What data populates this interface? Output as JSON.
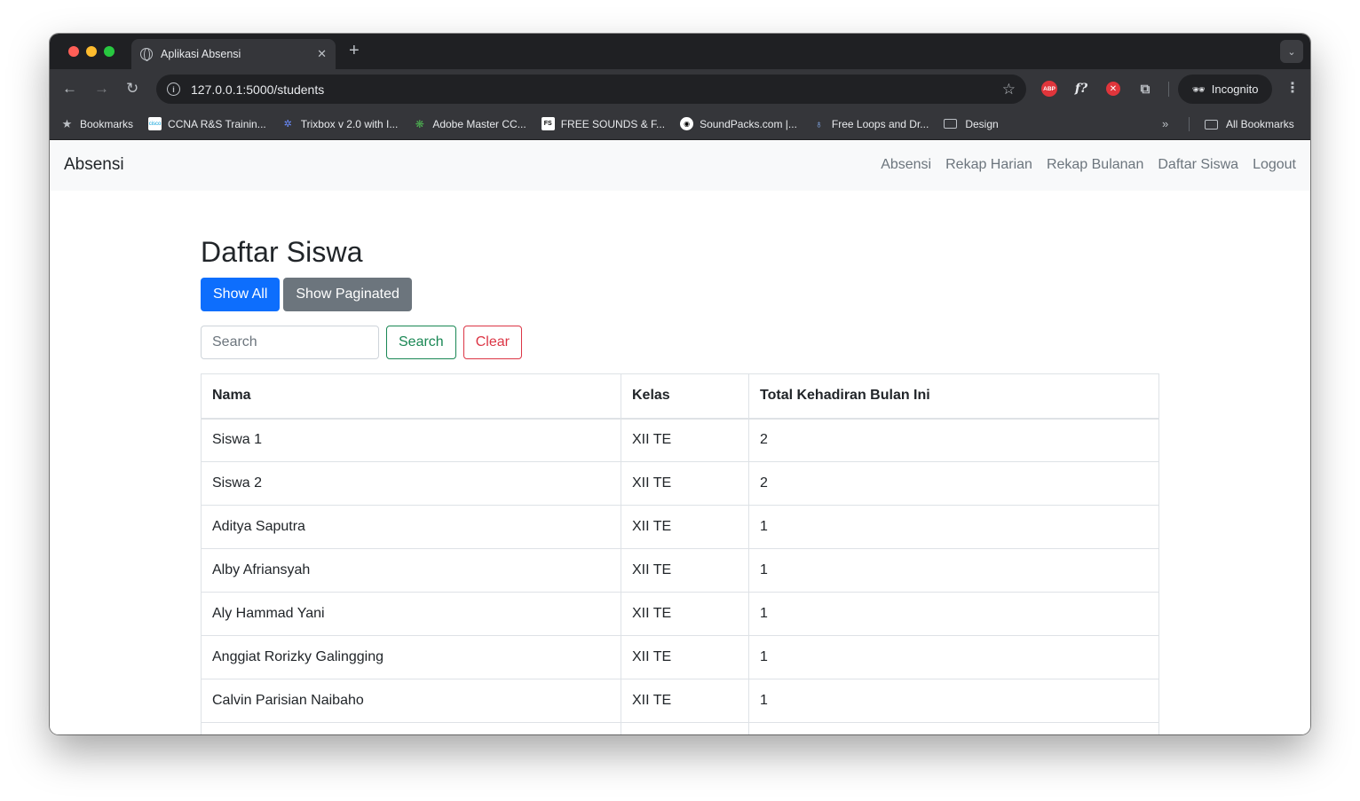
{
  "browser": {
    "tab_title": "Aplikasi Absensi",
    "url": "127.0.0.1:5000/students",
    "incognito_label": "Incognito",
    "bookmarks": [
      {
        "label": "Bookmarks",
        "icon": "star-icon"
      },
      {
        "label": "CCNA R&S Trainin...",
        "icon": "cisco-icon"
      },
      {
        "label": "Trixbox v 2.0 with I...",
        "icon": "trixbox-icon"
      },
      {
        "label": "Adobe Master CC...",
        "icon": "adobe-icon"
      },
      {
        "label": "FREE SOUNDS & F...",
        "icon": "free-sounds-icon"
      },
      {
        "label": "SoundPacks.com |...",
        "icon": "soundpacks-icon"
      },
      {
        "label": "Free Loops and Dr...",
        "icon": "free-loops-icon"
      },
      {
        "label": "Design",
        "icon": "folder-icon"
      }
    ],
    "all_bookmarks_label": "All Bookmarks"
  },
  "navbar": {
    "brand": "Absensi",
    "links": [
      "Absensi",
      "Rekap Harian",
      "Rekap Bulanan",
      "Daftar Siswa",
      "Logout"
    ]
  },
  "main": {
    "title": "Daftar Siswa",
    "show_all_label": "Show All",
    "show_paginated_label": "Show Paginated",
    "search_placeholder": "Search",
    "search_button_label": "Search",
    "clear_button_label": "Clear",
    "table": {
      "headers": [
        "Nama",
        "Kelas",
        "Total Kehadiran Bulan Ini"
      ],
      "rows": [
        [
          "Siswa 1",
          "XII TE",
          "2"
        ],
        [
          "Siswa 2",
          "XII TE",
          "2"
        ],
        [
          "Aditya Saputra",
          "XII TE",
          "1"
        ],
        [
          "Alby Afriansyah",
          "XII TE",
          "1"
        ],
        [
          "Aly Hammad Yani",
          "XII TE",
          "1"
        ],
        [
          "Anggiat Rorizky Galingging",
          "XII TE",
          "1"
        ],
        [
          "Calvin Parisian Naibaho",
          "XII TE",
          "1"
        ]
      ]
    }
  },
  "colors": {
    "primary": "#0d6efd",
    "secondary": "#6c757d",
    "success": "#198754",
    "danger": "#dc3545"
  }
}
